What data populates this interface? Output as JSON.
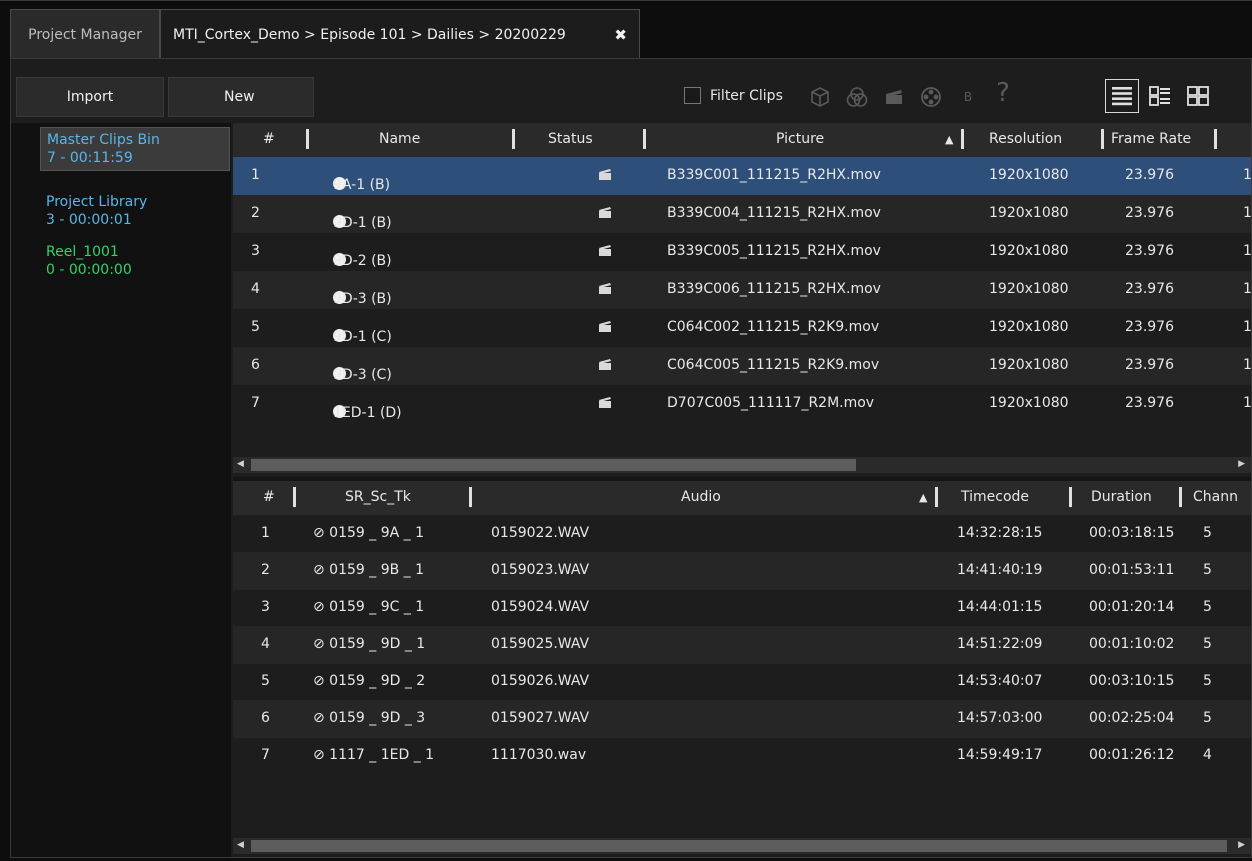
{
  "tabs": [
    {
      "label": "Project Manager",
      "active": false
    },
    {
      "label": "MTI_Cortex_Demo > Episode 101 > Dailies > 20200229",
      "active": true,
      "close": "✖"
    }
  ],
  "toolbar": {
    "import_label": "Import",
    "new_label": "New",
    "filter_label": "Filter Clips",
    "filter_checked": false,
    "icons": [
      "cube-icon",
      "color-circles-icon",
      "clapperboard-icon",
      "film-reel-icon",
      "b-icon",
      "help-icon"
    ],
    "b_label": "B",
    "help_label": "?",
    "views": [
      "list-view-icon",
      "detail-view-icon",
      "grid-view-icon"
    ]
  },
  "bins": [
    {
      "name": "Master Clips Bin",
      "meta": "7 - 00:11:59",
      "color": "#58b6e8",
      "selected": true
    },
    {
      "name": "Project Library",
      "meta": "3 - 00:00:01",
      "color": "#58b6e8",
      "selected": false
    },
    {
      "name": "Reel_1001",
      "meta": "0 - 00:00:00",
      "color": "#2fd36a",
      "selected": false
    }
  ],
  "clips": {
    "headers": {
      "num": "#",
      "name": "Name",
      "status": "Status",
      "picture": "Picture",
      "resolution": "Resolution",
      "frame_rate": "Frame Rate"
    },
    "rows": [
      {
        "num": "1",
        "name": "9A-1 (B)",
        "picture": "B339C001_111215_R2HX.mov",
        "resolution": "1920x1080",
        "frame_rate": "23.976",
        "extra": "1"
      },
      {
        "num": "2",
        "name": "9D-1 (B)",
        "picture": "B339C004_111215_R2HX.mov",
        "resolution": "1920x1080",
        "frame_rate": "23.976",
        "extra": "1"
      },
      {
        "num": "3",
        "name": "9D-2 (B)",
        "picture": "B339C005_111215_R2HX.mov",
        "resolution": "1920x1080",
        "frame_rate": "23.976",
        "extra": "1"
      },
      {
        "num": "4",
        "name": "9D-3 (B)",
        "picture": "B339C006_111215_R2HX.mov",
        "resolution": "1920x1080",
        "frame_rate": "23.976",
        "extra": "1"
      },
      {
        "num": "5",
        "name": "9D-1 (C)",
        "picture": "C064C002_111215_R2K9.mov",
        "resolution": "1920x1080",
        "frame_rate": "23.976",
        "extra": "1"
      },
      {
        "num": "6",
        "name": "9D-3 (C)",
        "picture": "C064C005_111215_R2K9.mov",
        "resolution": "1920x1080",
        "frame_rate": "23.976",
        "extra": "1"
      },
      {
        "num": "7",
        "name": "1ED-1 (D)",
        "picture": "D707C005_111117_R2M.mov",
        "resolution": "1920x1080",
        "frame_rate": "23.976",
        "extra": "1"
      }
    ]
  },
  "audio": {
    "headers": {
      "num": "#",
      "sr_sc_tk": "SR_Sc_Tk",
      "audio": "Audio",
      "timecode": "Timecode",
      "duration": "Duration",
      "channels": "Chann"
    },
    "rows": [
      {
        "num": "1",
        "sr_sc_tk": "⊘ 0159 _ 9A _ 1",
        "audio": "0159022.WAV",
        "timecode": "14:32:28:15",
        "duration": "00:03:18:15",
        "channels": "5"
      },
      {
        "num": "2",
        "sr_sc_tk": "⊘ 0159 _ 9B _ 1",
        "audio": "0159023.WAV",
        "timecode": "14:41:40:19",
        "duration": "00:01:53:11",
        "channels": "5"
      },
      {
        "num": "3",
        "sr_sc_tk": "⊘ 0159 _ 9C _ 1",
        "audio": "0159024.WAV",
        "timecode": "14:44:01:15",
        "duration": "00:01:20:14",
        "channels": "5"
      },
      {
        "num": "4",
        "sr_sc_tk": "⊘ 0159 _ 9D _ 1",
        "audio": "0159025.WAV",
        "timecode": "14:51:22:09",
        "duration": "00:01:10:02",
        "channels": "5"
      },
      {
        "num": "5",
        "sr_sc_tk": "⊘ 0159 _ 9D _ 2",
        "audio": "0159026.WAV",
        "timecode": "14:53:40:07",
        "duration": "00:03:10:15",
        "channels": "5"
      },
      {
        "num": "6",
        "sr_sc_tk": "⊘ 0159 _ 9D _ 3",
        "audio": "0159027.WAV",
        "timecode": "14:57:03:00",
        "duration": "00:02:25:04",
        "channels": "5"
      },
      {
        "num": "7",
        "sr_sc_tk": "⊘ 1117 _ 1ED _ 1",
        "audio": "1117030.wav",
        "timecode": "14:59:49:17",
        "duration": "00:01:26:12",
        "channels": "4"
      }
    ]
  },
  "colors": {
    "selection": "#2e4f7a",
    "bin_link": "#58b6e8",
    "reel": "#2fd36a"
  }
}
